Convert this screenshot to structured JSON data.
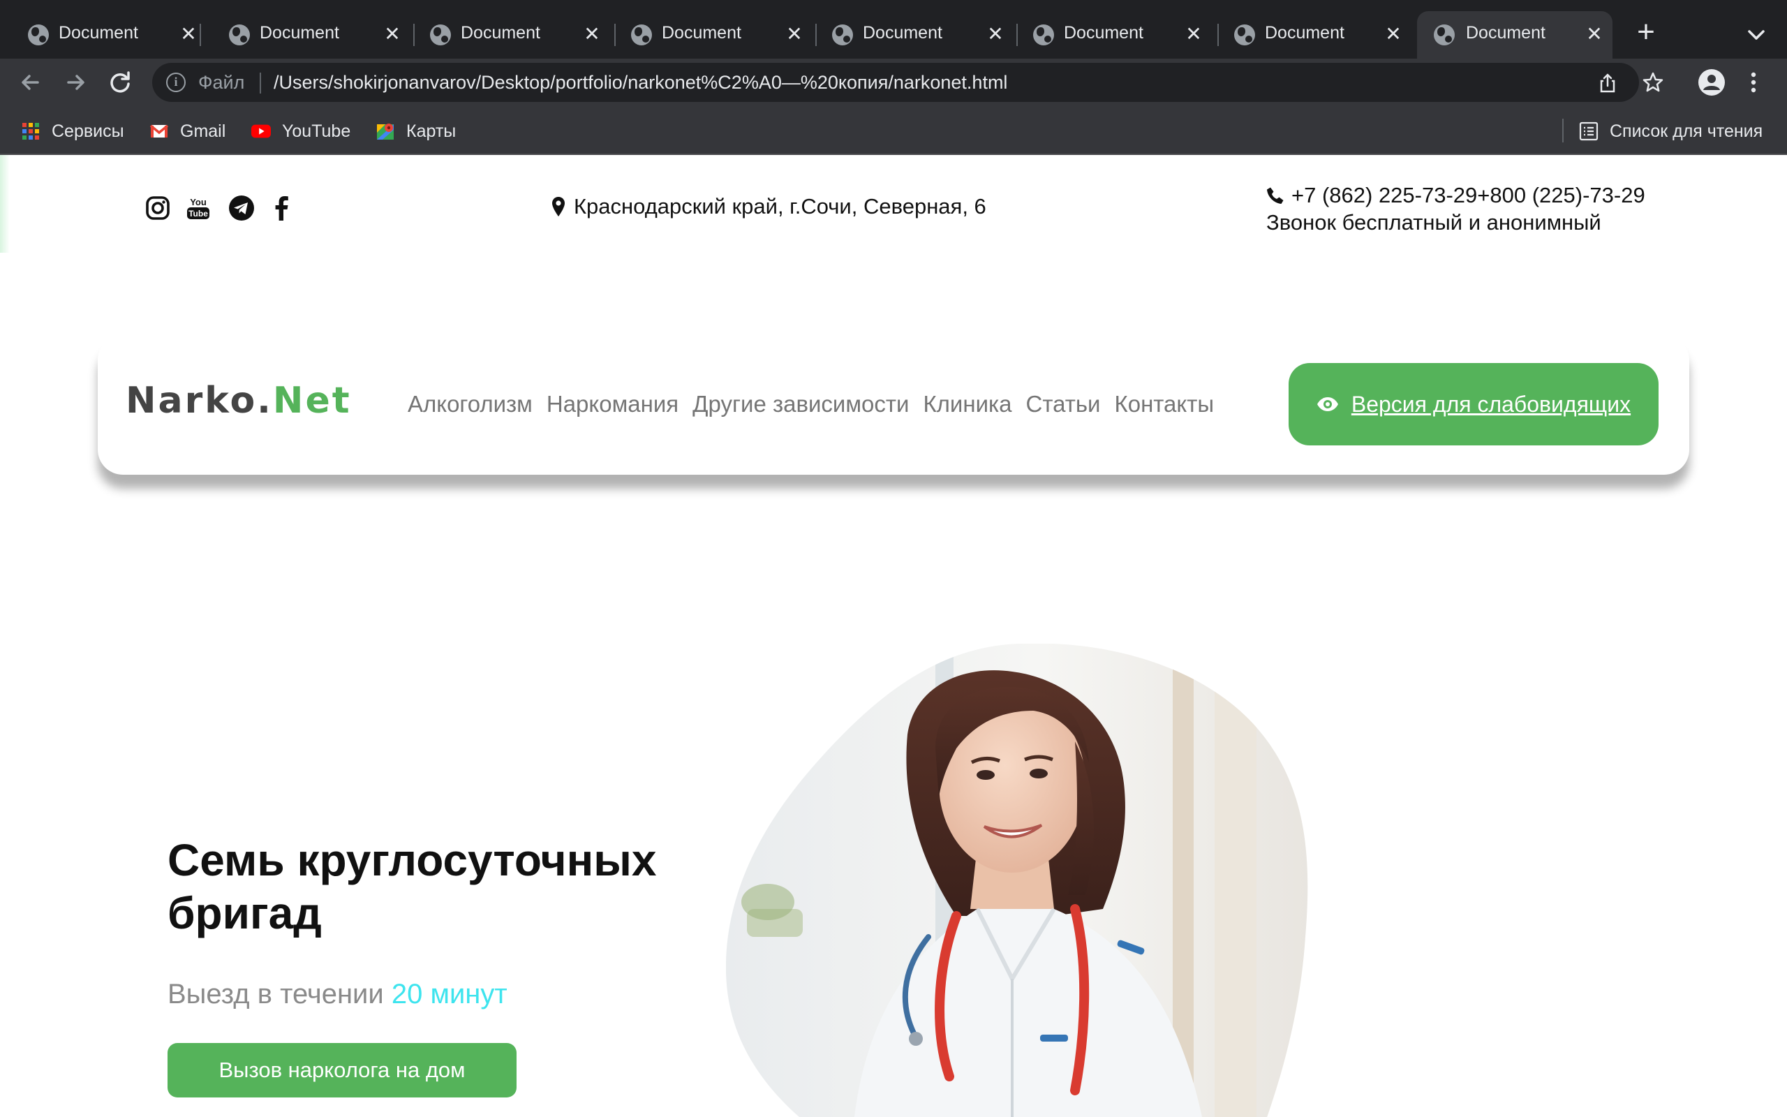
{
  "browser": {
    "tabs": [
      {
        "title": "Document",
        "active": false
      },
      {
        "title": "Document",
        "active": false
      },
      {
        "title": "Document",
        "active": false
      },
      {
        "title": "Document",
        "active": false
      },
      {
        "title": "Document",
        "active": false
      },
      {
        "title": "Document",
        "active": false
      },
      {
        "title": "Document",
        "active": false
      },
      {
        "title": "Document",
        "active": true
      }
    ],
    "omnibox": {
      "scheme_label": "Файл",
      "url": "/Users/shokirjonanvarov/Desktop/portfolio/narkonet%C2%A0—%20копия/narkonet.html"
    },
    "bookmarks": [
      {
        "label": "Сервисы",
        "icon": "apps-grid-icon"
      },
      {
        "label": "Gmail",
        "icon": "gmail-icon"
      },
      {
        "label": "YouTube",
        "icon": "youtube-icon"
      },
      {
        "label": "Карты",
        "icon": "maps-icon"
      }
    ],
    "reading_list_label": "Список для чтения"
  },
  "topbar": {
    "social_icons": [
      "instagram-icon",
      "youtube-icon",
      "telegram-icon",
      "facebook-icon"
    ],
    "address": "Краснодарский край, г.Сочи, Северная, 6",
    "phone": "+7 (862) 225-73-29+800 (225)-73-29",
    "phone_note": "Звонок бесплатный и анонимный"
  },
  "nav": {
    "logo_part1": "Narko.",
    "logo_part2": "Net",
    "menu": [
      "Алкоголизм",
      "Наркомания",
      "Другие зависимости",
      "Клиника",
      "Статьи",
      "Контакты"
    ],
    "accessibility_button": "Версия для слабовидящих"
  },
  "hero": {
    "title": "Семь круглосуточных бригад",
    "subtitle_prefix": "Выезд в течении",
    "subtitle_accent": "20 минут",
    "cta": "Вызов нарколога на дом"
  },
  "colors": {
    "brand_green": "#55b35a",
    "accent_cyan": "#3ee4ee",
    "chrome_dark": "#202124",
    "chrome_mid": "#35363a"
  }
}
